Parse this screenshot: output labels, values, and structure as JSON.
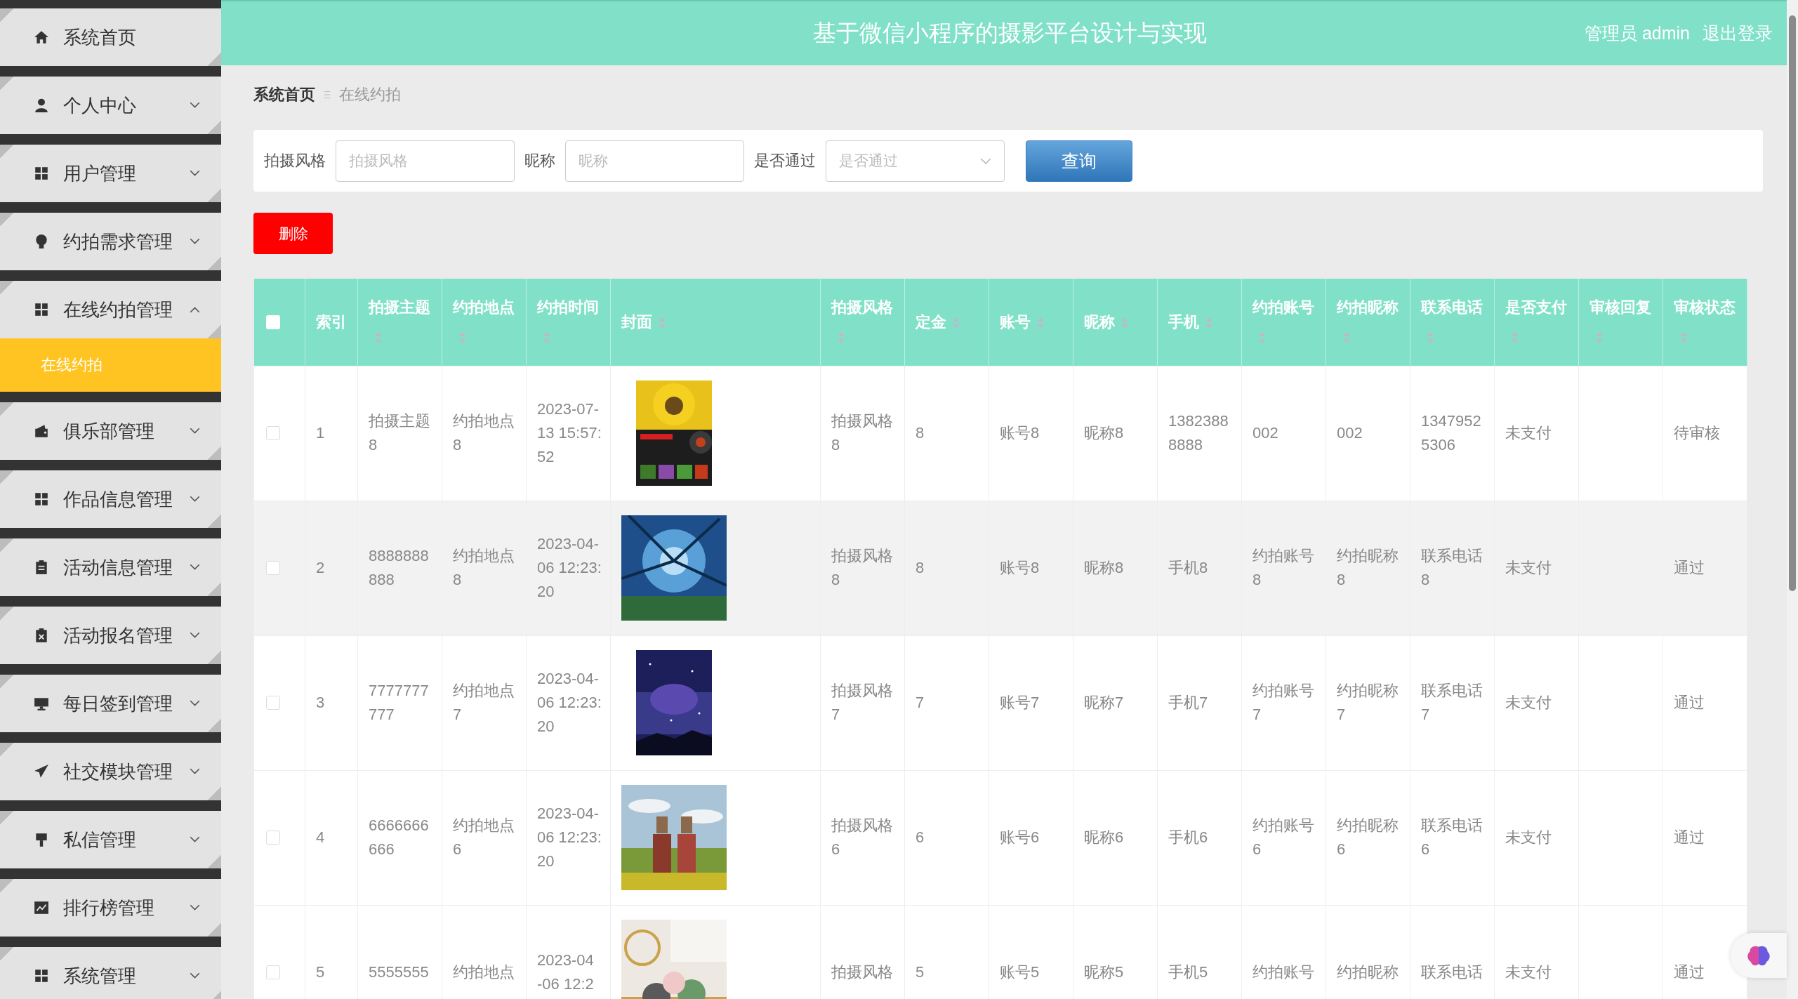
{
  "sidebar": {
    "items": [
      {
        "label": "系统首页",
        "kind": "link"
      },
      {
        "label": "个人中心",
        "kind": "menu",
        "expanded": false
      },
      {
        "label": "用户管理",
        "kind": "menu",
        "expanded": false
      },
      {
        "label": "约拍需求管理",
        "kind": "menu",
        "expanded": false
      },
      {
        "label": "在线约拍管理",
        "kind": "menu",
        "expanded": true,
        "children": [
          {
            "label": "在线约拍",
            "selected": true
          }
        ]
      },
      {
        "label": "俱乐部管理",
        "kind": "menu",
        "expanded": false
      },
      {
        "label": "作品信息管理",
        "kind": "menu",
        "expanded": false
      },
      {
        "label": "活动信息管理",
        "kind": "menu",
        "expanded": false
      },
      {
        "label": "活动报名管理",
        "kind": "menu",
        "expanded": false
      },
      {
        "label": "每日签到管理",
        "kind": "menu",
        "expanded": false
      },
      {
        "label": "社交模块管理",
        "kind": "menu",
        "expanded": false
      },
      {
        "label": "私信管理",
        "kind": "menu",
        "expanded": false
      },
      {
        "label": "排行榜管理",
        "kind": "menu",
        "expanded": false
      },
      {
        "label": "系统管理",
        "kind": "menu",
        "expanded": false
      }
    ]
  },
  "header": {
    "title": "基于微信小程序的摄影平台设计与实现",
    "user": "管理员 admin",
    "logout": "退出登录"
  },
  "breadcrumb": [
    "系统首页",
    "在线约拍"
  ],
  "search": {
    "fields": [
      {
        "label": "拍摄风格",
        "placeholder": "拍摄风格",
        "kind": "input"
      },
      {
        "label": "昵称",
        "placeholder": "昵称",
        "kind": "input"
      },
      {
        "label": "是否通过",
        "placeholder": "是否通过",
        "kind": "select"
      }
    ],
    "button": "查询"
  },
  "delete_button": "删除",
  "table": {
    "select_all": {
      "checked": false
    },
    "columns": [
      {
        "label": "索引",
        "sortable": false
      },
      {
        "label": "拍摄主题",
        "sortable": true
      },
      {
        "label": "约拍地点",
        "sortable": true
      },
      {
        "label": "约拍时间",
        "sortable": true
      },
      {
        "label": "封面",
        "sortable": true
      },
      {
        "label": "拍摄风格",
        "sortable": true
      },
      {
        "label": "定金",
        "sortable": true
      },
      {
        "label": "账号",
        "sortable": true
      },
      {
        "label": "昵称",
        "sortable": true
      },
      {
        "label": "手机",
        "sortable": true
      },
      {
        "label": "约拍账号",
        "sortable": true
      },
      {
        "label": "约拍昵称",
        "sortable": true
      },
      {
        "label": "联系电话",
        "sortable": true
      },
      {
        "label": "是否支付",
        "sortable": true
      },
      {
        "label": "审核回复",
        "sortable": true
      },
      {
        "label": "审核状态",
        "sortable": true
      }
    ],
    "rows": [
      {
        "checked": false,
        "hovered": false,
        "cells": [
          "1",
          "拍摄主题8",
          "约拍地点8",
          "2023-07-13 15:57:52",
          {
            "kind": "picture"
          },
          "拍摄风格8",
          "8",
          "账号8",
          "昵称8",
          "13823888888",
          "002",
          "002",
          "13479525306",
          "未支付",
          "",
          "待审核"
        ]
      },
      {
        "checked": false,
        "hovered": true,
        "cells": [
          "2",
          "8888888888",
          "约拍地点8",
          "2023-04-06 12:23:20",
          {
            "kind": "picture"
          },
          "拍摄风格8",
          "8",
          "账号8",
          "昵称8",
          "手机8",
          "约拍账号8",
          "约拍昵称8",
          "联系电话8",
          "未支付",
          "",
          "通过"
        ]
      },
      {
        "checked": false,
        "hovered": false,
        "cells": [
          "3",
          "7777777777",
          "约拍地点7",
          "2023-04-06 12:23:20",
          {
            "kind": "picture"
          },
          "拍摄风格7",
          "7",
          "账号7",
          "昵称7",
          "手机7",
          "约拍账号7",
          "约拍昵称7",
          "联系电话7",
          "未支付",
          "",
          "通过"
        ]
      },
      {
        "checked": false,
        "hovered": false,
        "cells": [
          "4",
          "6666666666",
          "约拍地点6",
          "2023-04-06 12:23:20",
          {
            "kind": "picture"
          },
          "拍摄风格6",
          "6",
          "账号6",
          "昵称6",
          "手机6",
          "约拍账号6",
          "约拍昵称6",
          "联系电话6",
          "未支付",
          "",
          "通过"
        ]
      },
      {
        "checked": false,
        "hovered": false,
        "cells": [
          "5",
          "5555555",
          "约拍地点",
          "2023-04 -06 12:2",
          {
            "kind": "picture"
          },
          "拍摄风格",
          "5",
          "账号5",
          "昵称5",
          "手机5",
          "约拍账号",
          "约拍昵称",
          "联系电话",
          "未支付",
          "",
          "通过"
        ]
      }
    ]
  }
}
